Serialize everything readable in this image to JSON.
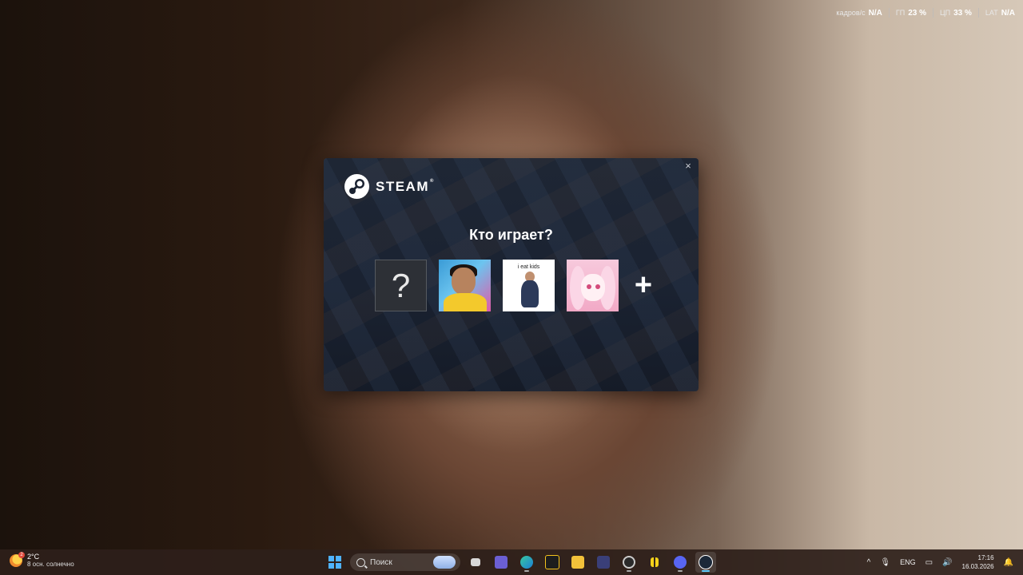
{
  "overlay": {
    "items": [
      {
        "label": "кадров/с",
        "value": "N/A"
      },
      {
        "label": "ГП",
        "value": "23 %"
      },
      {
        "label": "ЦП",
        "value": "33 %"
      },
      {
        "label": "LAT",
        "value": "N/A"
      }
    ]
  },
  "dialog": {
    "logo_text": "STEAM",
    "logo_tm": "®",
    "title": "Кто играет?",
    "close_label": "×",
    "avatars": [
      {
        "name": "unknown-user",
        "glyph": "?"
      },
      {
        "name": "user-man-yellow-shirt"
      },
      {
        "name": "user-i-eat-kids",
        "caption": "i eat kids"
      },
      {
        "name": "user-anime-girl"
      }
    ],
    "add_label": "+"
  },
  "taskbar": {
    "weather": {
      "temp": "2°C",
      "desc": "8 осн. солнечно",
      "badge": "2"
    },
    "search_placeholder": "Поиск",
    "tray": {
      "chevron": "^",
      "language": "ENG",
      "time": "17:16",
      "date": "16.03.2026"
    }
  },
  "colors": {
    "dialog_bg": "#1a2231",
    "windows_blue": "#4fb3ff",
    "taskbar_bg": "#2e201a"
  }
}
